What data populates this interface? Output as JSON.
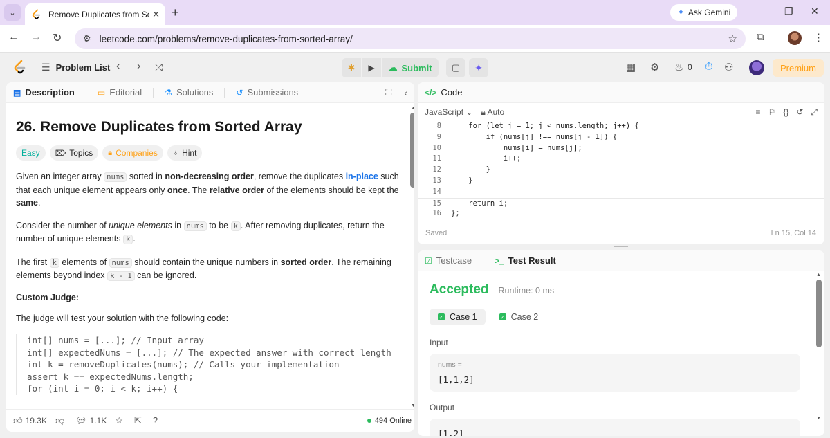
{
  "browser": {
    "tab_title": "Remove Duplicates from Sorted",
    "url": "leetcode.com/problems/remove-duplicates-from-sorted-array/",
    "gemini_label": "Ask Gemini"
  },
  "topbar": {
    "problem_list": "Problem List",
    "submit_label": "Submit",
    "streak_count": "0",
    "premium_label": "Premium"
  },
  "description": {
    "tabs": [
      "Description",
      "Editorial",
      "Solutions",
      "Submissions"
    ],
    "title": "26. Remove Duplicates from Sorted Array",
    "difficulty": "Easy",
    "chips": [
      "Topics",
      "Companies",
      "Hint"
    ],
    "p1": {
      "a": "Given an integer array ",
      "nums": "nums",
      "b": " sorted in ",
      "nondec": "non-decreasing order",
      "c": ", remove the duplicates ",
      "inplace": "in-place",
      "d": " such that each unique element appears only ",
      "once": "once",
      "e": ". The ",
      "relorder": "relative order",
      "f": " of the elements should be kept the ",
      "same": "same",
      "g": "."
    },
    "p2": {
      "a": "Consider the number of ",
      "unique": "unique elements",
      "b": " in ",
      "nums": "nums",
      "c": " to be ",
      "k": "k",
      "d": ". After removing duplicates, return the number of unique elements ",
      "k2": "k",
      "e": "."
    },
    "p3": {
      "a": "The first ",
      "k": "k",
      "b": " elements of ",
      "nums": "nums",
      "c": " should contain the unique numbers in ",
      "sorted": "sorted order",
      "d": ". The remaining elements beyond index ",
      "km1": "k - 1",
      "e": " can be ignored."
    },
    "judge_title": "Custom Judge:",
    "judge_text": "The judge will test your solution with the following code:",
    "judge_code": [
      "int[] nums = [...]; // Input array",
      "int[] expectedNums = [...]; // The expected answer with correct length",
      "",
      "int k = removeDuplicates(nums); // Calls your implementation",
      "",
      "assert k == expectedNums.length;",
      "for (int i = 0; i < k; i++) {"
    ],
    "footer": {
      "likes": "19.3K",
      "comments": "1.1K",
      "online": "494 Online"
    }
  },
  "code": {
    "header": "Code",
    "language": "JavaScript",
    "mode": "Auto",
    "lines": [
      {
        "n": "8",
        "t": "    for (let j = 1; j < nums.length; j++) {"
      },
      {
        "n": "9",
        "t": "        if (nums[j] !== nums[j - 1]) {"
      },
      {
        "n": "10",
        "t": "            nums[i] = nums[j];"
      },
      {
        "n": "11",
        "t": "            i++;"
      },
      {
        "n": "12",
        "t": "        }"
      },
      {
        "n": "13",
        "t": "    }"
      },
      {
        "n": "14",
        "t": ""
      },
      {
        "n": "15",
        "t": "    return i;"
      },
      {
        "n": "16",
        "t": "};"
      }
    ],
    "status": "Saved",
    "cursor": "Ln 15, Col 14"
  },
  "result": {
    "tabs": [
      "Testcase",
      "Test Result"
    ],
    "verdict": "Accepted",
    "runtime": "Runtime: 0 ms",
    "cases": [
      "Case 1",
      "Case 2"
    ],
    "input_label": "Input",
    "input_var": "nums =",
    "input_val": "[1,1,2]",
    "output_label": "Output",
    "output_val": "[1,2]"
  },
  "colors": {
    "accent_orange": "#ffa116",
    "accepted_green": "#2cbb5d",
    "easy_teal": "#00af9b",
    "link_blue": "#1a73e8"
  }
}
